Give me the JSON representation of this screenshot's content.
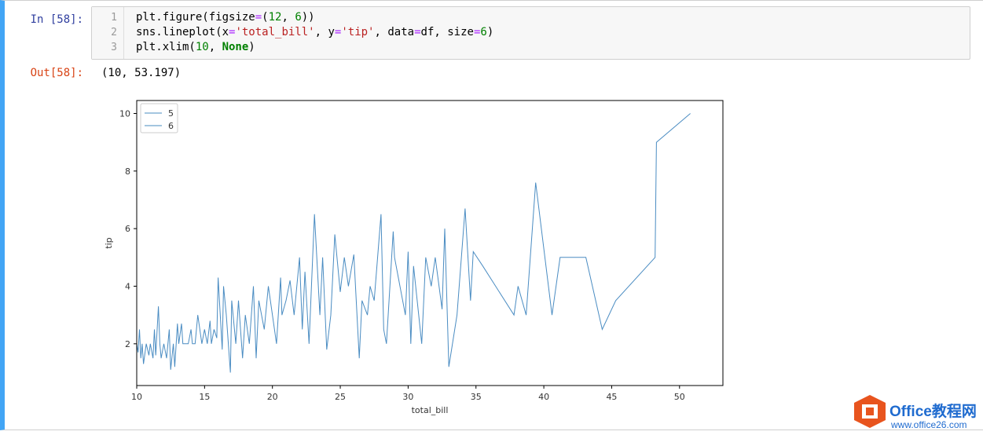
{
  "cell": {
    "in_prompt": "In  [58]:",
    "out_prompt": "Out[58]:",
    "line_numbers": [
      "1",
      "2",
      "3"
    ],
    "code": {
      "l1_a": "plt.figure(figsize",
      "l1_b": "=",
      "l1_c": "(",
      "l1_d": "12",
      "l1_e": ", ",
      "l1_f": "6",
      "l1_g": "))",
      "l2_a": "sns.lineplot(x",
      "l2_b": "=",
      "l2_c": "'total_bill'",
      "l2_d": ", y",
      "l2_e": "=",
      "l2_f": "'tip'",
      "l2_g": ", data",
      "l2_h": "=",
      "l2_i": "df, size",
      "l2_j": "=",
      "l2_k": "6",
      "l2_l": ")",
      "l3_a": "plt.xlim(",
      "l3_b": "10",
      "l3_c": ", ",
      "l3_d": "None",
      "l3_e": ")"
    },
    "output_text": "(10, 53.197)"
  },
  "chart_data": {
    "type": "line",
    "xlabel": "total_bill",
    "ylabel": "tip",
    "xlim": [
      10,
      53.197
    ],
    "ylim": [
      0.55,
      10.45
    ],
    "xticks": [
      10,
      15,
      20,
      25,
      30,
      35,
      40,
      45,
      50
    ],
    "yticks": [
      2,
      4,
      6,
      8,
      10
    ],
    "legend": {
      "location": "upper-left",
      "entries": [
        "5",
        "6"
      ]
    },
    "line_color": "#4a8cc2",
    "series": [
      {
        "x": [
          10.0,
          10.1,
          10.2,
          10.3,
          10.4,
          10.5,
          10.7,
          10.9,
          11.0,
          11.2,
          11.3,
          11.4,
          11.6,
          11.7,
          11.8,
          12.0,
          12.2,
          12.4,
          12.5,
          12.7,
          12.8,
          13.0,
          13.1,
          13.3,
          13.4,
          13.6,
          13.8,
          14.0,
          14.1,
          14.3,
          14.5,
          14.8,
          15.0,
          15.2,
          15.4,
          15.5,
          15.7,
          15.9,
          16.0,
          16.3,
          16.4,
          16.6,
          16.9,
          17.0,
          17.3,
          17.5,
          17.8,
          18.0,
          18.3,
          18.6,
          18.8,
          19.0,
          19.4,
          19.7,
          20.0,
          20.3,
          20.6,
          20.7,
          21.0,
          21.3,
          21.6,
          22.0,
          22.2,
          22.4,
          22.7,
          23.1,
          23.5,
          23.7,
          24.0,
          24.3,
          24.6,
          25.0,
          25.3,
          25.6,
          26.0,
          26.4,
          26.6,
          27.0,
          27.2,
          27.5,
          28.0,
          28.2,
          28.4,
          28.9,
          29.0,
          29.8,
          30.0,
          30.2,
          30.4,
          31.0,
          31.3,
          31.7,
          32.0,
          32.5,
          32.7,
          33.0,
          33.6,
          34.2,
          34.6,
          34.8,
          35.5,
          37.8,
          38.1,
          38.7,
          39.4,
          40.6,
          41.2,
          43.1,
          44.3,
          45.3,
          48.2,
          48.3,
          50.8
        ],
        "y": [
          2.0,
          1.7,
          2.5,
          1.5,
          2.0,
          1.3,
          2.0,
          1.6,
          2.0,
          1.5,
          2.5,
          1.6,
          3.3,
          2.0,
          1.5,
          2.0,
          1.5,
          2.5,
          1.1,
          2.0,
          1.2,
          2.7,
          2.0,
          2.7,
          2.0,
          2.0,
          2.0,
          2.5,
          2.0,
          2.0,
          3.0,
          2.0,
          2.5,
          2.0,
          2.8,
          2.0,
          2.5,
          2.2,
          4.3,
          1.8,
          4.0,
          3.0,
          1.0,
          3.5,
          2.0,
          3.5,
          1.5,
          3.0,
          2.0,
          4.0,
          1.5,
          3.5,
          2.5,
          4.0,
          3.0,
          2.0,
          4.3,
          3.0,
          3.5,
          4.2,
          3.0,
          5.0,
          2.5,
          4.5,
          2.0,
          6.5,
          3.0,
          5.0,
          1.8,
          3.0,
          5.8,
          3.8,
          5.0,
          4.0,
          5.1,
          1.5,
          3.5,
          3.0,
          4.0,
          3.5,
          6.5,
          2.5,
          2.0,
          5.9,
          5.0,
          3.0,
          5.2,
          2.0,
          4.7,
          2.0,
          5.0,
          4.0,
          5.0,
          3.2,
          6.0,
          1.2,
          3.0,
          6.7,
          3.5,
          5.2,
          4.7,
          3.0,
          4.0,
          3.0,
          7.6,
          3.0,
          5.0,
          5.0,
          2.5,
          3.5,
          5.0,
          9.0,
          10.0
        ]
      }
    ]
  },
  "watermark": {
    "brand": "Office教程网",
    "url": "www.office26.com",
    "icon": "office-logo-icon",
    "color": "#1f6bcf",
    "accent": "#e8541e"
  }
}
